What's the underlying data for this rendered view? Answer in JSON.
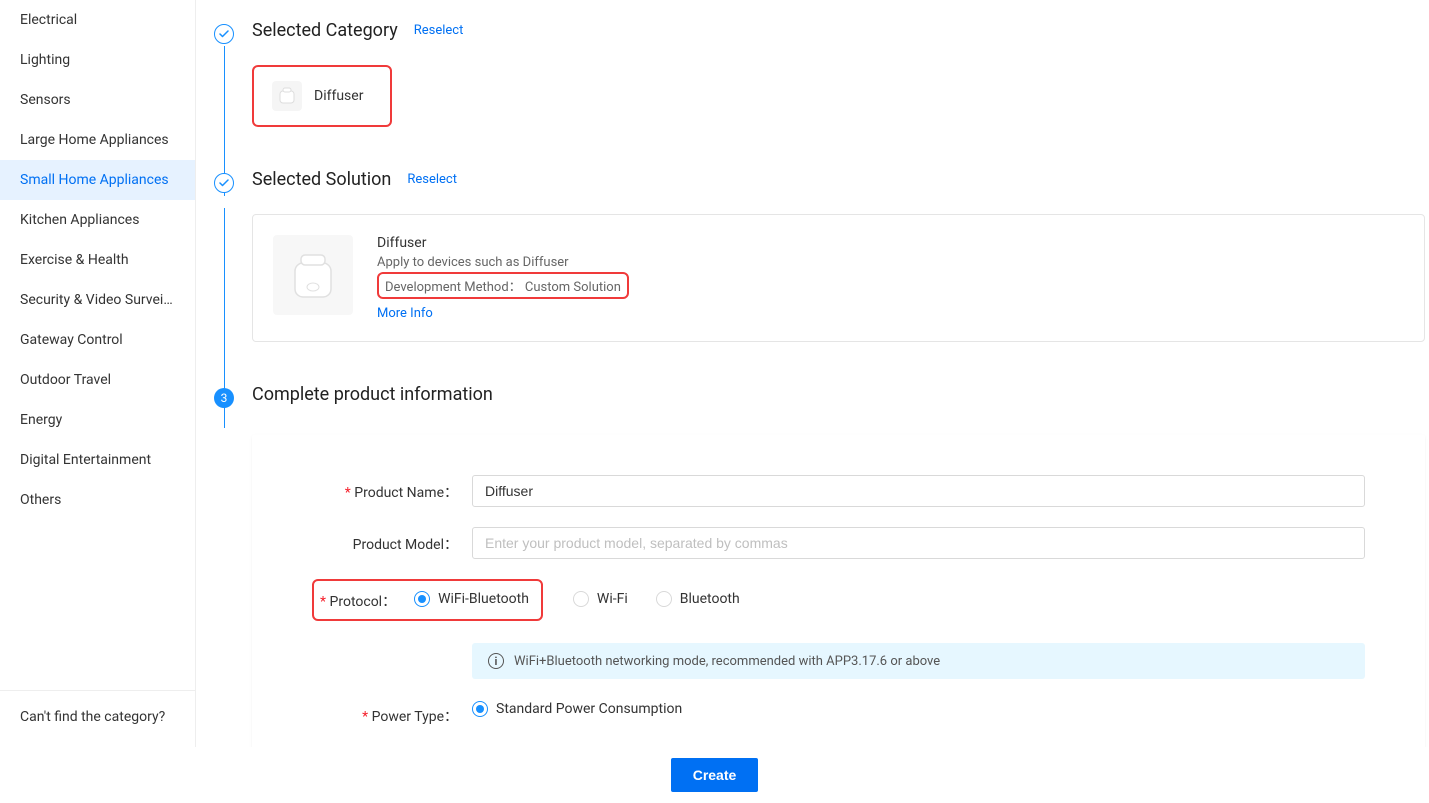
{
  "sidebar": {
    "items": [
      {
        "label": "Electrical"
      },
      {
        "label": "Lighting"
      },
      {
        "label": "Sensors"
      },
      {
        "label": "Large Home Appliances"
      },
      {
        "label": "Small Home Appliances"
      },
      {
        "label": "Kitchen Appliances"
      },
      {
        "label": "Exercise & Health"
      },
      {
        "label": "Security & Video Surveill…"
      },
      {
        "label": "Gateway Control"
      },
      {
        "label": "Outdoor Travel"
      },
      {
        "label": "Energy"
      },
      {
        "label": "Digital Entertainment"
      },
      {
        "label": "Others"
      }
    ],
    "footer": "Can't find the category?"
  },
  "steps": {
    "category": {
      "title": "Selected Category",
      "reselect": "Reselect",
      "name": "Diffuser"
    },
    "solution": {
      "title": "Selected Solution",
      "reselect": "Reselect",
      "card": {
        "name": "Diffuser",
        "desc": "Apply to devices such as Diffuser",
        "dev_method": "Development Method： Custom Solution",
        "more": "More Info"
      }
    },
    "product_info": {
      "marker": "3",
      "title": "Complete product information",
      "product_name": {
        "label": "Product Name：",
        "value": "Diffuser"
      },
      "product_model": {
        "label": "Product Model：",
        "placeholder": "Enter your product model, separated by commas"
      },
      "protocol": {
        "label": "Protocol：",
        "options": [
          "WiFi-Bluetooth",
          "Wi-Fi",
          "Bluetooth"
        ],
        "info": "WiFi+Bluetooth networking mode, recommended with APP3.17.6 or above"
      },
      "power_type": {
        "label": "Power Type：",
        "options": [
          "Standard Power Consumption"
        ]
      }
    }
  },
  "footer": {
    "create": "Create"
  }
}
